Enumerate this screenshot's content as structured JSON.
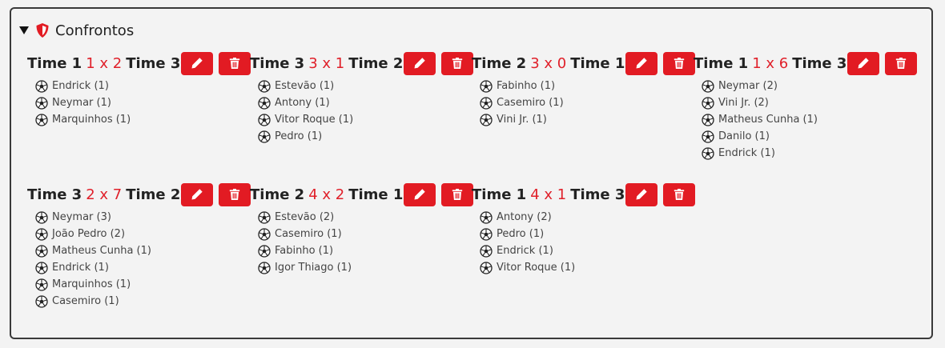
{
  "section": {
    "title": "Confrontos",
    "icons": {
      "toggle": "triangle-down-icon",
      "badge": "shield-icon"
    },
    "accent_color": "#e21b23",
    "score_color": "#e0202a"
  },
  "matches": [
    {
      "home": "Time 1",
      "score": "1 x 2",
      "away": "Time 3",
      "scorers": [
        "Endrick (1)",
        "Neymar (1)",
        "Marquinhos (1)"
      ]
    },
    {
      "home": "Time 3",
      "score": "3 x 1",
      "away": "Time 2",
      "scorers": [
        "Estevão (1)",
        "Antony (1)",
        "Vitor Roque (1)",
        "Pedro (1)"
      ]
    },
    {
      "home": "Time 2",
      "score": "3 x 0",
      "away": "Time 1",
      "scorers": [
        "Fabinho (1)",
        "Casemiro (1)",
        "Vini Jr. (1)"
      ]
    },
    {
      "home": "Time 1",
      "score": "1 x 6",
      "away": "Time 3",
      "scorers": [
        "Neymar (2)",
        "Vini Jr. (2)",
        "Matheus Cunha (1)",
        "Danilo (1)",
        "Endrick (1)"
      ]
    },
    {
      "home": "Time 3",
      "score": "2 x 7",
      "away": "Time 2",
      "scorers": [
        "Neymar (3)",
        "João Pedro (2)",
        "Matheus Cunha (1)",
        "Endrick (1)",
        "Marquinhos (1)",
        "Casemiro (1)"
      ]
    },
    {
      "home": "Time 2",
      "score": "4 x 2",
      "away": "Time 1",
      "scorers": [
        "Estevão (2)",
        "Casemiro (1)",
        "Fabinho (1)",
        "Igor Thiago (1)"
      ]
    },
    {
      "home": "Time 1",
      "score": "4 x 1",
      "away": "Time 3",
      "scorers": [
        "Antony (2)",
        "Pedro (1)",
        "Endrick (1)",
        "Vitor Roque (1)"
      ]
    }
  ]
}
